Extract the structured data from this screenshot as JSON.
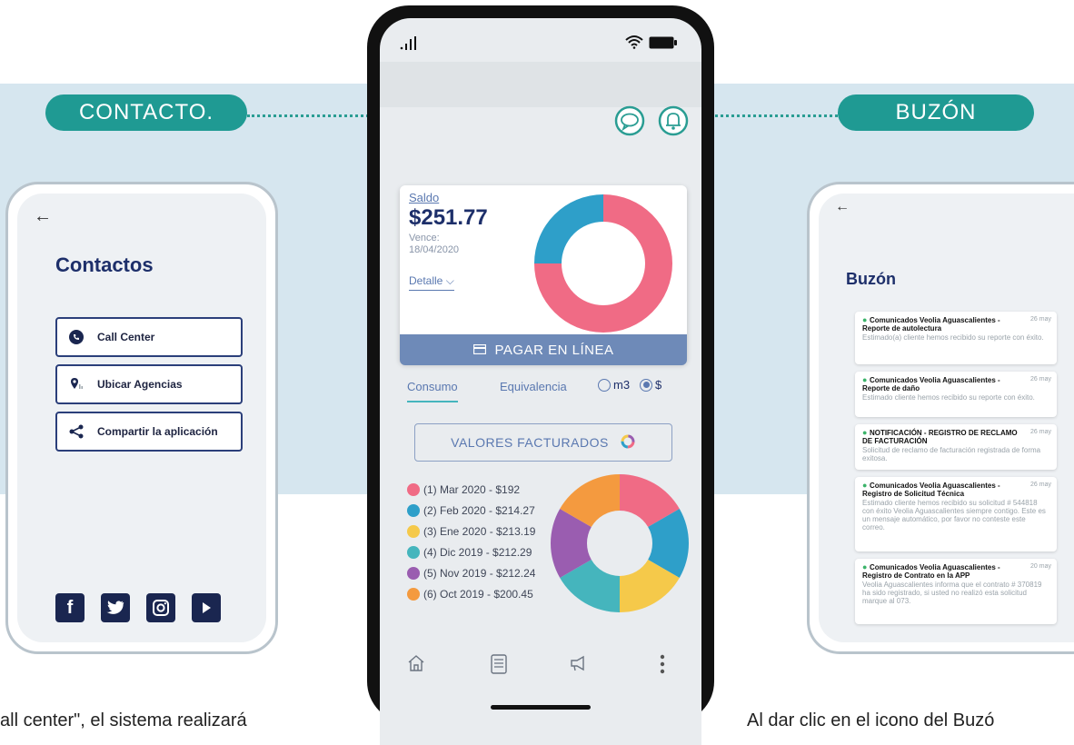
{
  "labels": {
    "contacto": "CONTACTO.",
    "buzon": "BUZÓN"
  },
  "contactos": {
    "back": "←",
    "title": "Contactos",
    "buttons": [
      "Call Center",
      "Ubicar Agencias",
      "Compartir la aplicación"
    ],
    "social": [
      "facebook-icon",
      "twitter-icon",
      "instagram-icon",
      "youtube-icon"
    ]
  },
  "center": {
    "saldo_label": "Saldo",
    "saldo_value": "$251.77",
    "vence_label": "Vence:",
    "vence_date": "18/04/2020",
    "detalle": "Detalle",
    "pay_button": "PAGAR EN LÍNEA",
    "tab_consumo": "Consumo",
    "tab_equivalencia": "Equivalencia",
    "radio_m3": "m3",
    "radio_dollar": "$",
    "valores_button": "VALORES FACTURADOS",
    "legend": [
      {
        "label": "(1) Mar 2020 - $192",
        "color": "#f06b85"
      },
      {
        "label": "(2) Feb 2020 - $214.27",
        "color": "#2e9fc9"
      },
      {
        "label": "(3) Ene 2020 - $213.19",
        "color": "#f5c94a"
      },
      {
        "label": "(4) Dic 2019 - $212.29",
        "color": "#45b5bd"
      },
      {
        "label": "(5) Nov 2019 - $212.24",
        "color": "#9a5db0"
      },
      {
        "label": "(6) Oct 2019 - $200.45",
        "color": "#f49a3f"
      }
    ],
    "donut1": [
      {
        "value": 0.75,
        "color": "#f06b85"
      },
      {
        "value": 0.25,
        "color": "#2e9fc9"
      }
    ],
    "nav": [
      "home-icon",
      "document-icon",
      "megaphone-icon",
      "more-icon"
    ]
  },
  "buzon": {
    "back": "←",
    "title": "Buzón",
    "items": [
      {
        "title": "Comunicados Veolia Aguascalientes - Reporte de autolectura",
        "date": "26 may",
        "desc": "Estimado(a) cliente hemos recibido su reporte con éxito."
      },
      {
        "title": "Comunicados Veolia Aguascalientes - Reporte de daño",
        "date": "26 may",
        "desc": "Estimado cliente hemos recibido su reporte con éxito."
      },
      {
        "title": "NOTIFICACIÓN - REGISTRO DE RECLAMO DE FACTURACIÓN",
        "date": "26 may",
        "desc": "Solicitud de reclamo de facturación registrada de forma exitosa."
      },
      {
        "title": "Comunicados Veolia Aguascalientes - Registro de Solicitud Técnica",
        "date": "26 may",
        "desc": "Estimado cliente hemos recibido su solicitud # 544818 con éxito Veolia Aguascalientes siempre contigo. Este es un mensaje automático, por favor no conteste este correo."
      },
      {
        "title": "Comunicados Veolia Aguascalientes - Registro de Contrato en la APP",
        "date": "20 may",
        "desc": "Veolia Aguascalientes informa que el contrato # 370819 ha sido registrado, si usted no realizó esta solicitud marque al 073."
      }
    ]
  },
  "captions": {
    "left": "all center\", el sistema realizará",
    "right": "Al dar clic en el icono del Buzó"
  }
}
